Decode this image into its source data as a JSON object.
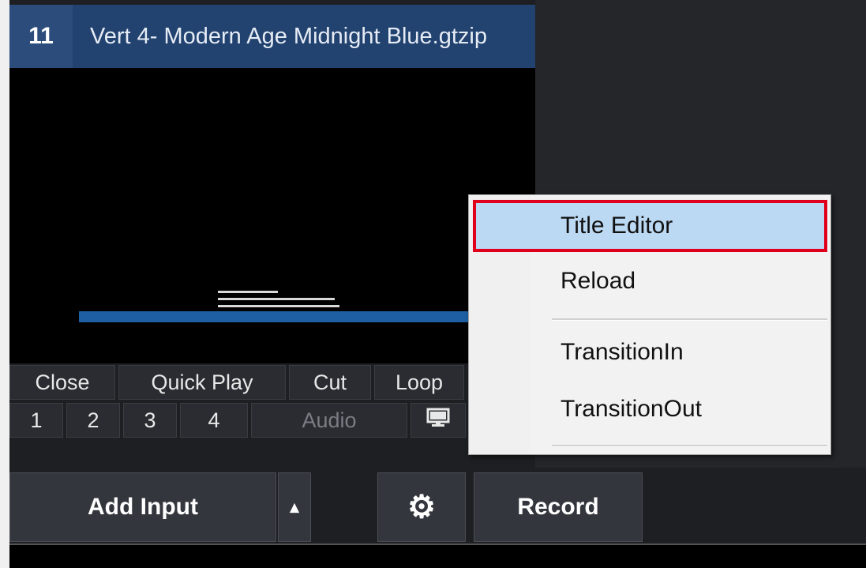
{
  "input": {
    "number": "11",
    "title": "Vert 4- Modern Age Midnight Blue.gtzip"
  },
  "input_controls": {
    "row1": [
      "Close",
      "Quick Play",
      "Cut",
      "Loop"
    ],
    "row2": [
      "1",
      "2",
      "3",
      "4",
      "Audio"
    ]
  },
  "toolbar": {
    "add_input": "Add Input",
    "add_input_dropdown": "▴",
    "settings": "⚙",
    "record": "Record"
  },
  "context_menu": {
    "items": [
      "Title Editor",
      "Reload",
      "TransitionIn",
      "TransitionOut"
    ]
  },
  "colors": {
    "highlight_outline": "#e0001b",
    "menu_selection": "#bcd9f3",
    "input_header": "#22426f"
  }
}
